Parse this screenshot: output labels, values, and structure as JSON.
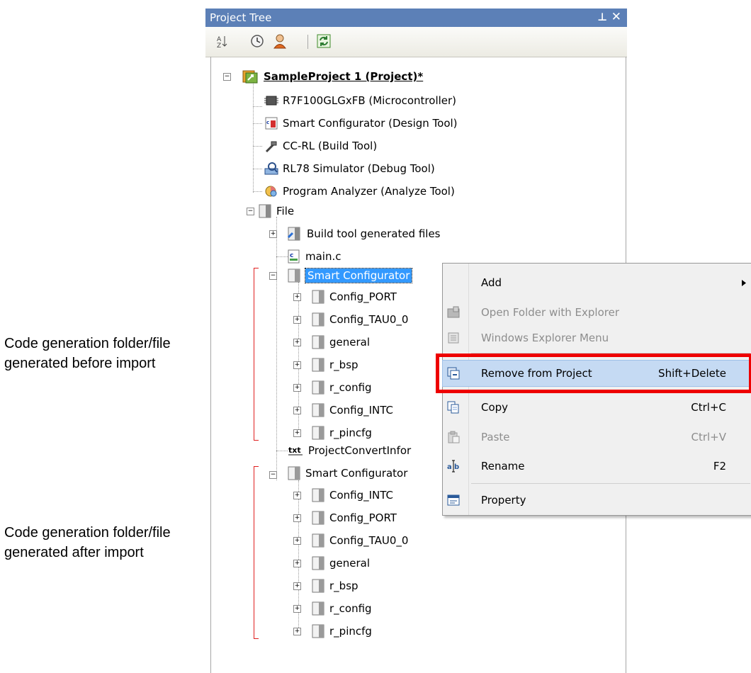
{
  "panel": {
    "title": "Project Tree",
    "pin_glyph": "⊥",
    "close_glyph": "✕"
  },
  "toolbar": {
    "icons": [
      "sort-icon",
      "clock-icon",
      "user-icon",
      "refresh-icon"
    ]
  },
  "tree": {
    "project": "SampleProject 1  (Project)*",
    "microcontroller": "R7F100GLGxFB (Microcontroller)",
    "design_tool": "Smart Configurator (Design Tool)",
    "build_tool": "CC-RL (Build Tool)",
    "debug_tool": "RL78 Simulator (Debug Tool)",
    "analyze_tool": "Program Analyzer (Analyze Tool)",
    "file": "File",
    "build_generated": "Build tool generated files",
    "main_c": "main.c",
    "sc_folder_1": "Smart Configurator",
    "before_items": [
      "Config_PORT",
      "Config_TAU0_0",
      "general",
      "r_bsp",
      "r_config",
      "Config_INTC",
      "r_pincfg"
    ],
    "convert_info": "ProjectConvertInfor",
    "sc_folder_2": "Smart Configurator",
    "after_items": [
      "Config_INTC",
      "Config_PORT",
      "Config_TAU0_0",
      "general",
      "r_bsp",
      "r_config",
      "r_pincfg"
    ]
  },
  "annotations": {
    "before_line1": "Code generation folder/file",
    "before_line2": "generated before import",
    "after_line1": "Code generation folder/file",
    "after_line2": "generated after import"
  },
  "context_menu": {
    "add": "Add",
    "open_folder": "Open Folder with Explorer",
    "explorer_menu": "Windows Explorer Menu",
    "remove": "Remove from Project",
    "remove_key": "Shift+Delete",
    "copy": "Copy",
    "copy_key": "Ctrl+C",
    "paste": "Paste",
    "paste_key": "Ctrl+V",
    "rename": "Rename",
    "rename_key": "F2",
    "property": "Property"
  },
  "colors": {
    "title_bar": "#5c80b7",
    "selection": "#3399ff",
    "highlight": "#ee0000",
    "bracket": "#e02020"
  }
}
